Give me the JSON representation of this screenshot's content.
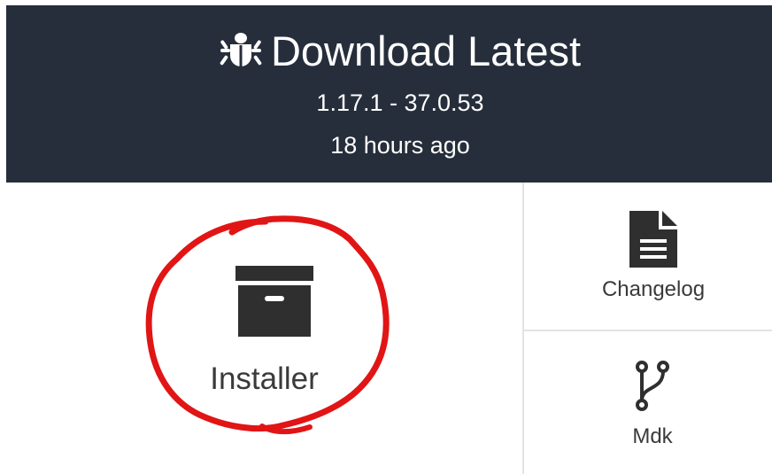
{
  "header": {
    "title": "Download Latest",
    "version": "1.17.1 - 37.0.53",
    "released": "18 hours ago"
  },
  "downloads": {
    "installer": {
      "label": "Installer",
      "icon": "archive-box-icon"
    },
    "changelog": {
      "label": "Changelog",
      "icon": "document-icon"
    },
    "mdk": {
      "label": "Mdk",
      "icon": "git-branch-icon"
    }
  },
  "annotation": {
    "color": "#e11515"
  },
  "colors": {
    "header_bg": "#262e3b",
    "icon": "#2f2f2f",
    "divider": "#e3e3e3"
  }
}
